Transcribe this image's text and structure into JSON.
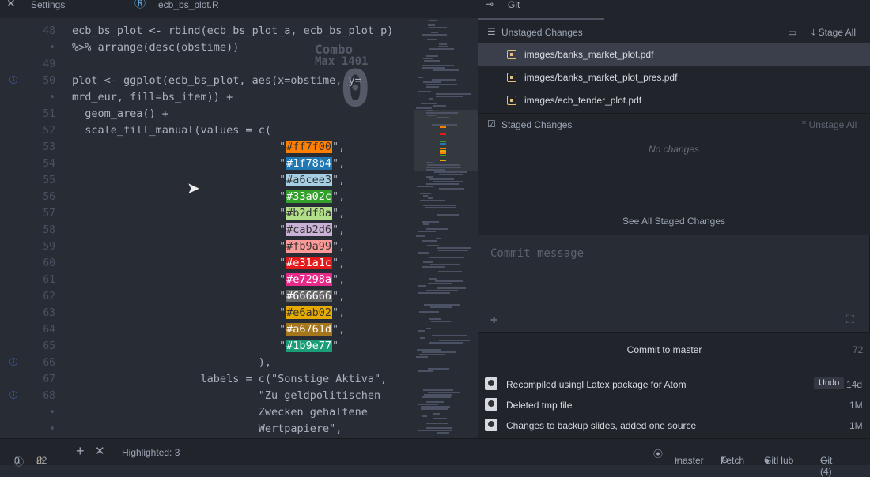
{
  "tabs": [
    {
      "label": "Settings",
      "icon": "tools-icon"
    },
    {
      "label": "ecb_bs_plot.R",
      "icon": "r-icon"
    }
  ],
  "combo": {
    "label": "Combo",
    "max": "Max 1401",
    "count": "0"
  },
  "lines": [
    {
      "n": "48",
      "code": "ecb_bs_plot <- rbind(ecb_bs_plot_a, ecb_bs_plot_p)"
    },
    {
      "n": "•",
      "code": "%>% arrange(desc(obstime))"
    },
    {
      "n": "49",
      "code": ""
    },
    {
      "n": "50",
      "code": "plot <- ggplot(ecb_bs_plot, aes(x=obstime, y="
    },
    {
      "n": "•",
      "code": "mrd_eur, fill=bs_item)) +"
    },
    {
      "n": "51",
      "code": "  geom_area() +"
    },
    {
      "n": "52",
      "code": "  scale_fill_manual(values = c("
    },
    {
      "n": "53",
      "code": "#ff7f00",
      "sw": "#ff7f00",
      "end": ","
    },
    {
      "n": "54",
      "code": "#1f78b4",
      "sw": "#1f78b4",
      "end": ","
    },
    {
      "n": "55",
      "code": "#a6cee3",
      "sw": "#a6cee3",
      "end": ","
    },
    {
      "n": "56",
      "code": "#33a02c",
      "sw": "#33a02c",
      "end": ","
    },
    {
      "n": "57",
      "code": "#b2df8a",
      "sw": "#b2df8a",
      "end": ","
    },
    {
      "n": "58",
      "code": "#cab2d6",
      "sw": "#cab2d6",
      "end": ","
    },
    {
      "n": "59",
      "code": "#fb9a99",
      "sw": "#fb9a99",
      "end": ","
    },
    {
      "n": "60",
      "code": "#e31a1c",
      "sw": "#e31a1c",
      "end": ","
    },
    {
      "n": "61",
      "code": "#e7298a",
      "sw": "#e7298a",
      "end": ","
    },
    {
      "n": "62",
      "code": "#666666",
      "sw": "#666666",
      "end": ","
    },
    {
      "n": "63",
      "code": "#e6ab02",
      "sw": "#e6ab02",
      "end": ","
    },
    {
      "n": "64",
      "code": "#a6761d",
      "sw": "#a6761d",
      "end": ","
    },
    {
      "n": "65",
      "code": "#1b9e77",
      "sw": "#1b9e77",
      "end": ""
    },
    {
      "n": "66",
      "code": "                             ),"
    },
    {
      "n": "67",
      "code": "                    labels = c(\"Sonstige Aktiva\","
    },
    {
      "n": "68",
      "code": "                             \"Zu geldpolitischen"
    },
    {
      "n": "•",
      "code": "                             Zwecken gehaltene"
    },
    {
      "n": "•",
      "code": "                             Wertpapiere\","
    }
  ],
  "git": {
    "tab": "Git",
    "unstaged_title": "Unstaged Changes",
    "stage_all": "Stage All",
    "unstaged": [
      "images/banks_market_plot.pdf",
      "images/banks_market_plot_pres.pdf",
      "images/ecb_tender_plot.pdf"
    ],
    "staged_title": "Staged Changes",
    "unstage_all": "Unstage All",
    "no_changes": "No changes",
    "see_all": "See All Staged Changes",
    "commit_placeholder": "Commit message",
    "commit_button": "Commit to master",
    "commit_count": "72",
    "recent": [
      {
        "msg": "Recompiled usingl Latex package for Atom",
        "undo": "Undo",
        "age": "14d"
      },
      {
        "msg": "Deleted tmp file",
        "age": "1M"
      },
      {
        "msg": "Changes to backup slides, added one source",
        "age": "1M"
      }
    ]
  },
  "status": {
    "errors": "0",
    "warnings": "82",
    "highlighted": "Highlighted: 3",
    "branch": "master",
    "fetch": "Fetch",
    "github": "GitHub",
    "git": "Git (4)"
  }
}
